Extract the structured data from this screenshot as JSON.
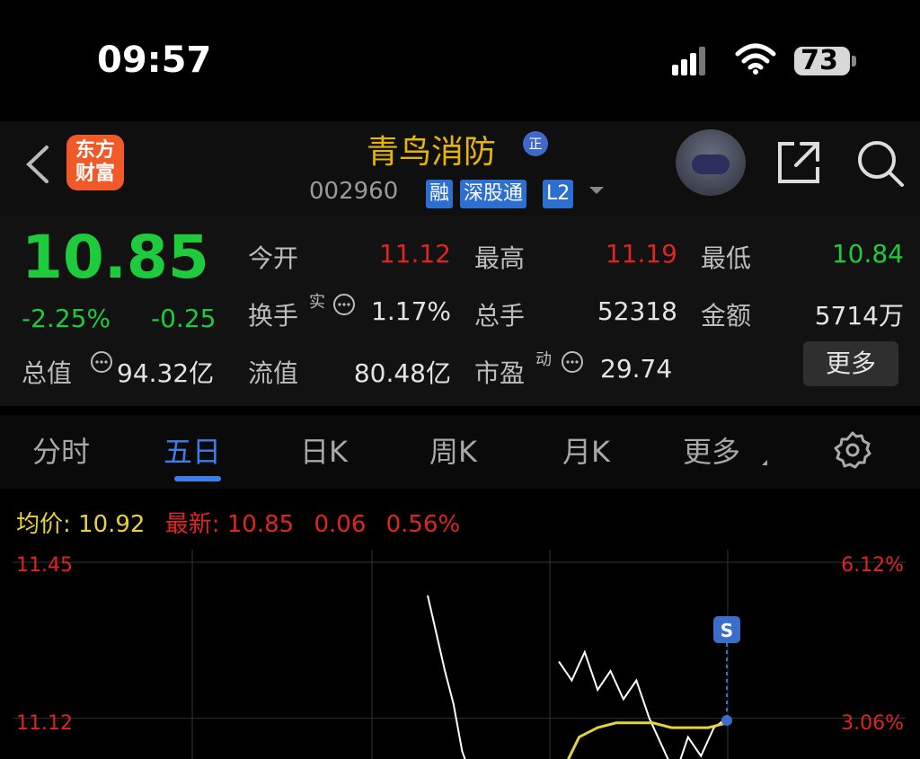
{
  "status_bar": {
    "time": "09:57",
    "battery": "73"
  },
  "header": {
    "logo_line1": "东方",
    "logo_line2": "财富",
    "stock_name": "青鸟消防",
    "name_badge": "正",
    "stock_code": "002960",
    "tags": [
      "融",
      "深股通",
      "L2"
    ]
  },
  "quote": {
    "price": "10.85",
    "change_pct": "-2.25%",
    "change_amt": "-0.25",
    "open_label": "今开",
    "open_value": "11.12",
    "high_label": "最高",
    "high_value": "11.19",
    "low_label": "最低",
    "low_value": "10.84",
    "turnover_label": "换手",
    "turnover_sup": "实",
    "turnover_value": "1.17%",
    "volume_label": "总手",
    "volume_value": "52318",
    "amount_label": "金额",
    "amount_value": "5714万",
    "mktcap_label": "总值",
    "mktcap_value": "94.32亿",
    "float_label": "流值",
    "float_value": "80.48亿",
    "pe_label": "市盈",
    "pe_sup": "动",
    "pe_value": "29.74",
    "more_label": "更多"
  },
  "tabs": [
    "分时",
    "五日",
    "日K",
    "周K",
    "月K",
    "更多"
  ],
  "active_tab": "五日",
  "chart_info": {
    "avg_label": "均价:",
    "avg_value": "10.92",
    "latest_label": "最新:",
    "latest_value": "10.85",
    "latest_change": "0.06",
    "latest_pct": "0.56%"
  },
  "colors": {
    "up": "#e02424",
    "down": "#1ecb3c",
    "accent": "#3d7fe8",
    "title": "#e8b600",
    "avg_line": "#e6d23a"
  },
  "chart_data": {
    "type": "line",
    "y_left_ticks": [
      "11.45",
      "11.12"
    ],
    "y_right_ticks": [
      "6.12%",
      "3.06%"
    ],
    "marker_label": "S",
    "series": [
      {
        "values": [
          11.38,
          11.3,
          11.22,
          11.15,
          11.05,
          11.0
        ]
      },
      {
        "values": [
          11.24,
          11.2,
          11.26,
          11.18,
          11.22,
          11.16,
          11.2,
          11.12,
          11.06,
          11.0,
          11.08,
          11.04,
          11.1,
          11.12
        ]
      },
      {
        "values": [
          11.0,
          11.08,
          11.1,
          11.11,
          11.11,
          11.11,
          11.1,
          11.1,
          11.1,
          11.11
        ]
      }
    ],
    "ylim": [
      10.95,
      11.45
    ],
    "grid": true
  }
}
